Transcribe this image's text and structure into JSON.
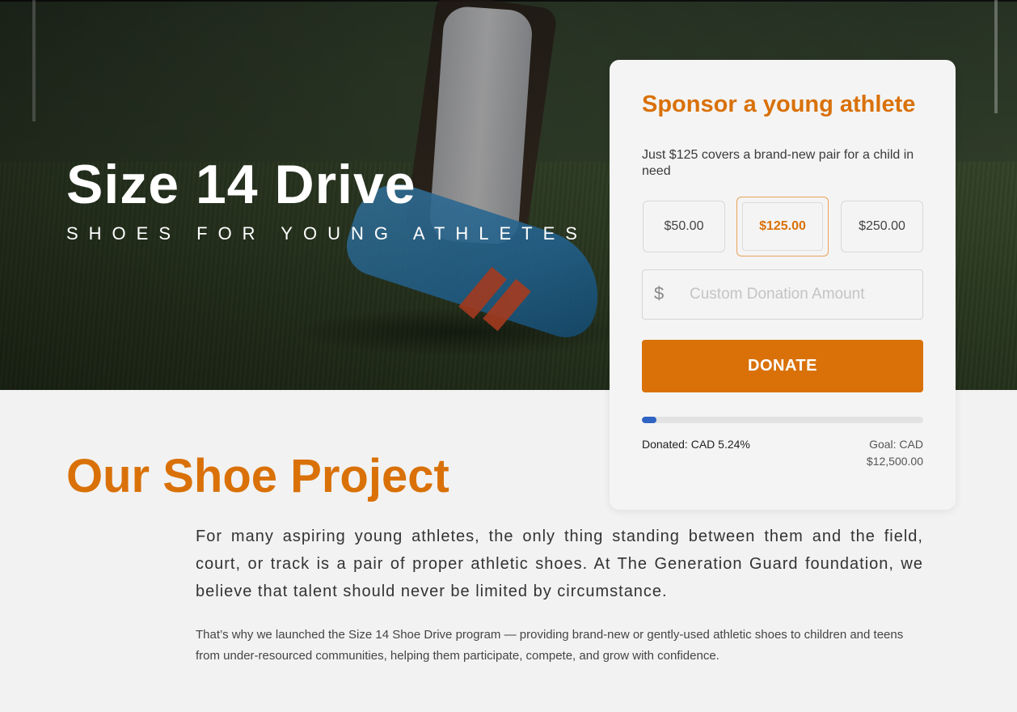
{
  "hero": {
    "title": "Size 14 Drive",
    "subtitle": "SHOES FOR YOUNG ATHLETES"
  },
  "donation_card": {
    "title": "Sponsor a young athlete",
    "subtitle": "Just $125 covers a brand-new pair for a child in need",
    "amounts": [
      {
        "label": "$50.00",
        "selected": false
      },
      {
        "label": "$125.00",
        "selected": true
      },
      {
        "label": "$250.00",
        "selected": false
      }
    ],
    "currency_symbol": "$",
    "custom_amount": {
      "value": "",
      "placeholder": "Custom Donation Amount"
    },
    "donate_label": "DONATE",
    "progress": {
      "percent": 5.24,
      "donated_label": "Donated: CAD 5.24%",
      "goal_label": "Goal: CAD $12,500.00"
    }
  },
  "section": {
    "title": "Our Shoe Project",
    "lead": "For many aspiring young athletes, the only thing standing between them and the field, court, or track is a pair of proper athletic shoes. At The Generation Guard foundation, we believe that talent should never be limited by circumstance.",
    "body": "That’s why we launched the Size 14 Shoe Drive program — providing brand-new or gently-used athletic shoes to children and teens from under-resourced communities, helping them participate, compete, and grow with confidence."
  },
  "colors": {
    "accent": "#d97108",
    "progress": "#2f63c4",
    "background": "#f2f2f2"
  }
}
